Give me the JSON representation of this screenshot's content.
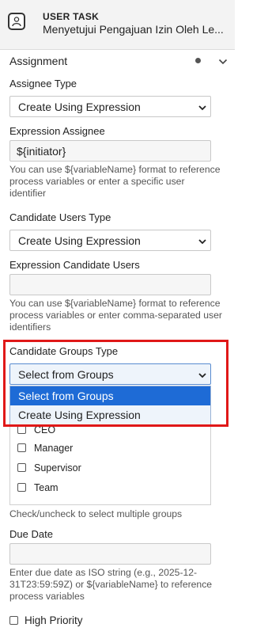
{
  "header": {
    "kind": "USER TASK",
    "title": "Menyetujui Pengajuan Izin Oleh Le..."
  },
  "section": {
    "label": "Assignment",
    "icons": [
      "dot-indicator-icon",
      "chevron-down-icon"
    ]
  },
  "assignee_type": {
    "label": "Assignee Type",
    "value": "Create Using Expression"
  },
  "expression_assignee": {
    "label": "Expression Assignee",
    "value": "${initiator}",
    "help": "You can use ${variableName} format to reference process variables or enter a specific user identifier"
  },
  "candidate_users_type": {
    "label": "Candidate Users Type",
    "value": "Create Using Expression"
  },
  "expression_candidate_users": {
    "label": "Expression Candidate Users",
    "value": "",
    "help": "You can use ${variableName} format to reference process variables or enter comma-separated user identifiers"
  },
  "candidate_groups_type": {
    "label": "Candidate Groups Type",
    "value": "Select from Groups",
    "options": [
      "Select from Groups",
      "Create Using Expression"
    ]
  },
  "groups": {
    "items": [
      "CEO",
      "Manager",
      "Supervisor",
      "Team"
    ],
    "help": "Check/uncheck to select multiple groups"
  },
  "due_date": {
    "label": "Due Date",
    "value": "",
    "help": "Enter due date as ISO string (e.g., 2025-12-31T23:59:59Z) or ${variableName} to reference process variables"
  },
  "high_priority": {
    "label": "High Priority",
    "checked": false
  },
  "colors": {
    "highlight": "#e01818",
    "selected_option": "#1e6bd6"
  }
}
